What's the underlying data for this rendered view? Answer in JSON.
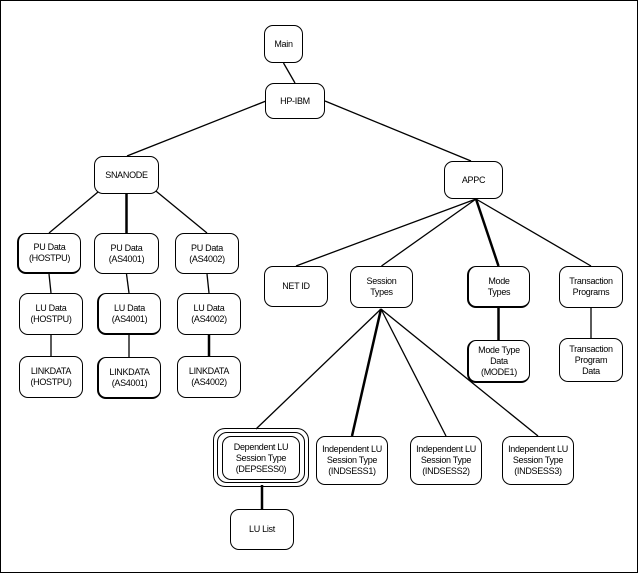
{
  "nodes": {
    "main": "Main",
    "hpibm": "HP-IBM",
    "snanode": "SNANODE",
    "appc": "APPC",
    "pu_hostpu": "PU Data\n(HOSTPU)",
    "pu_as4001": "PU Data\n(AS4001)",
    "pu_as4002": "PU Data\n(AS4002)",
    "lu_hostpu": "LU Data\n(HOSTPU)",
    "lu_as4001": "LU Data\n(AS4001)",
    "lu_as4002": "LU Data\n(AS4002)",
    "link_hostpu": "LINKDATA\n(HOSTPU)",
    "link_as4001": "LINKDATA\n(AS4001)",
    "link_as4002": "LINKDATA\n(AS4002)",
    "netid": "NET ID",
    "session_types": "Session\nTypes",
    "mode_types": "Mode\nTypes",
    "tp": "Transaction\nPrograms",
    "mode_data": "Mode Type\nData\n(MODE1)",
    "tp_data": "Transaction\nProgram\nData",
    "depsess0": "Dependent LU\nSession Type\n(DEPSESS0)",
    "indsess1": "Independent LU\nSession Type\n(INDSESS1)",
    "indsess2": "Independent LU\nSession Type\n(INDSESS2)",
    "indsess3": "Independent LU\nSession Type\n(INDSESS3)",
    "lu_list": "LU List"
  },
  "edges": [
    [
      "main",
      "hpibm"
    ],
    [
      "hpibm",
      "snanode"
    ],
    [
      "hpibm",
      "appc"
    ],
    [
      "snanode",
      "pu_hostpu"
    ],
    [
      "snanode",
      "pu_as4001"
    ],
    [
      "snanode",
      "pu_as4002"
    ],
    [
      "pu_hostpu",
      "lu_hostpu"
    ],
    [
      "pu_as4001",
      "lu_as4001"
    ],
    [
      "pu_as4002",
      "lu_as4002"
    ],
    [
      "lu_hostpu",
      "link_hostpu"
    ],
    [
      "lu_as4001",
      "link_as4001"
    ],
    [
      "lu_as4002",
      "link_as4002"
    ],
    [
      "appc",
      "netid"
    ],
    [
      "appc",
      "session_types"
    ],
    [
      "appc",
      "mode_types"
    ],
    [
      "appc",
      "tp"
    ],
    [
      "mode_types",
      "mode_data"
    ],
    [
      "tp",
      "tp_data"
    ],
    [
      "session_types",
      "depsess0"
    ],
    [
      "session_types",
      "indsess1"
    ],
    [
      "session_types",
      "indsess2"
    ],
    [
      "session_types",
      "indsess3"
    ],
    [
      "depsess0",
      "lu_list"
    ]
  ],
  "selected_node": "depsess0"
}
